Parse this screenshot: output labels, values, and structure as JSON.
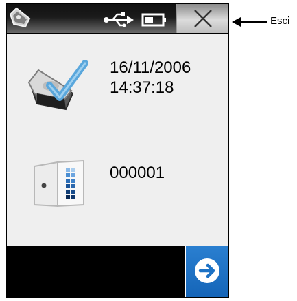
{
  "header": {
    "left_icon": "sensor-icon",
    "status_icons": [
      "usb-icon",
      "battery-icon"
    ],
    "close_icon": "close-icon"
  },
  "main": {
    "date": "16/11/2006",
    "time": "14:37:18",
    "serial": "000001",
    "date_icon": "calibration-check-icon",
    "serial_icon": "color-sample-book-icon"
  },
  "footer": {
    "next_icon": "arrow-right-circle-icon"
  },
  "annotation": {
    "exit_label": "Esci"
  },
  "colors": {
    "topbar": "#111111",
    "screen": "#efefef",
    "next_button": "#1d72c5",
    "check_mark": "#5aa7dc"
  }
}
